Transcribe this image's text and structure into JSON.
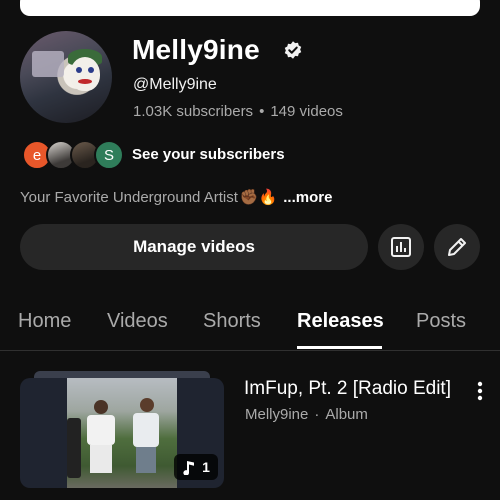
{
  "channel": {
    "name": "Melly9ine",
    "handle": "@Melly9ine",
    "subscribers": "1.03K subscribers",
    "separator": "•",
    "videos": "149 videos",
    "verified_icon": "verified-badge-icon"
  },
  "subscribers_preview": {
    "avatars": [
      {
        "initial": "e",
        "color": "#e8572a"
      },
      {
        "initial": "",
        "color": "#3d3a38"
      },
      {
        "initial": "",
        "color": "#2a241f"
      },
      {
        "initial": "S",
        "color": "#2f7d5a"
      }
    ],
    "label": "See your subscribers"
  },
  "bio": {
    "text": "Your Favorite Underground Artist",
    "emoji": "✊🏾🔥",
    "more": "...more"
  },
  "actions": {
    "manage_videos": "Manage videos",
    "analytics_icon": "analytics-icon",
    "edit_icon": "pencil-icon"
  },
  "tabs": [
    {
      "label": "Home",
      "active": false
    },
    {
      "label": "Videos",
      "active": false
    },
    {
      "label": "Shorts",
      "active": false
    },
    {
      "label": "Releases",
      "active": true
    },
    {
      "label": "Posts",
      "active": false
    }
  ],
  "release": {
    "title": "ImFup, Pt. 2 [Radio Edit]",
    "artist": "Melly9ine",
    "separator": "·",
    "type": "Album",
    "track_count": "1"
  },
  "colors": {
    "background": "#0f0f0f",
    "button_bg": "#272727",
    "secondary_text": "#aaaaaa"
  }
}
